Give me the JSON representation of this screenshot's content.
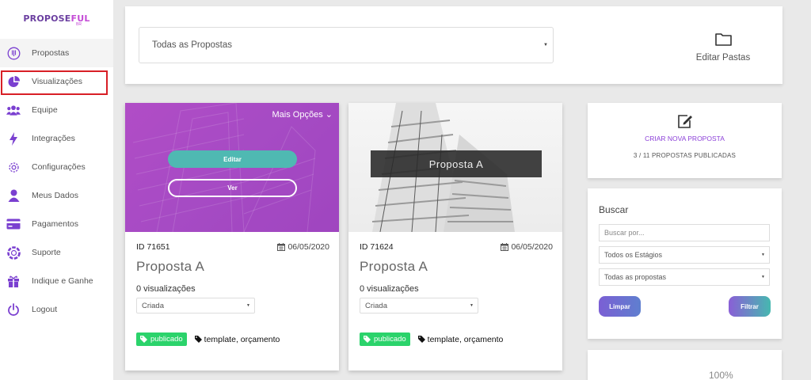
{
  "logo": {
    "main": "PROPOSE",
    "accent": "FUL",
    "sub": "BR"
  },
  "sidebar": {
    "items": [
      {
        "label": "Propostas",
        "icon": "proposals-icon"
      },
      {
        "label": "Visualizações",
        "icon": "pie-chart-icon"
      },
      {
        "label": "Equipe",
        "icon": "team-icon"
      },
      {
        "label": "Integrações",
        "icon": "bolt-icon"
      },
      {
        "label": "Configurações",
        "icon": "gear-icon"
      },
      {
        "label": "Meus Dados",
        "icon": "user-icon"
      },
      {
        "label": "Pagamentos",
        "icon": "credit-card-icon"
      },
      {
        "label": "Suporte",
        "icon": "lifebuoy-icon"
      },
      {
        "label": "Indique e Ganhe",
        "icon": "gift-icon"
      },
      {
        "label": "Logout",
        "icon": "power-icon"
      }
    ],
    "active_index": 1
  },
  "folders": {
    "selected": "Todas as Propostas",
    "edit_label": "Editar Pastas"
  },
  "cards": [
    {
      "more_options": "Mais Opções",
      "edit_label": "Editar",
      "view_label": "Ver",
      "id": "ID 71651",
      "date": "06/05/2020",
      "title": "Proposta A",
      "views": "0 visualizações",
      "stage": "Criada",
      "badge": "publicado",
      "tags": "template, orçamento"
    },
    {
      "overlay_title": "Proposta A",
      "id": "ID 71624",
      "date": "06/05/2020",
      "title": "Proposta A",
      "views": "0 visualizações",
      "stage": "Criada",
      "badge": "publicado",
      "tags": "template, orçamento"
    }
  ],
  "create": {
    "label": "CRIAR NOVA PROPOSTA",
    "published": "3 / 11 PROPOSTAS PUBLICADAS"
  },
  "search": {
    "title": "Buscar",
    "placeholder": "Buscar por...",
    "stage_filter": "Todos os Estágios",
    "proposals_filter": "Todas as propostas",
    "clear_label": "Limpar",
    "filter_label": "Filtrar"
  },
  "stats": {
    "percent": "100%"
  },
  "colors": {
    "brand": "#8b3fd8",
    "sidebar_icon": "#7a3fd0",
    "badge": "#2bd36b",
    "teal": "#4fb9b2",
    "highlight": "#d81f26"
  }
}
